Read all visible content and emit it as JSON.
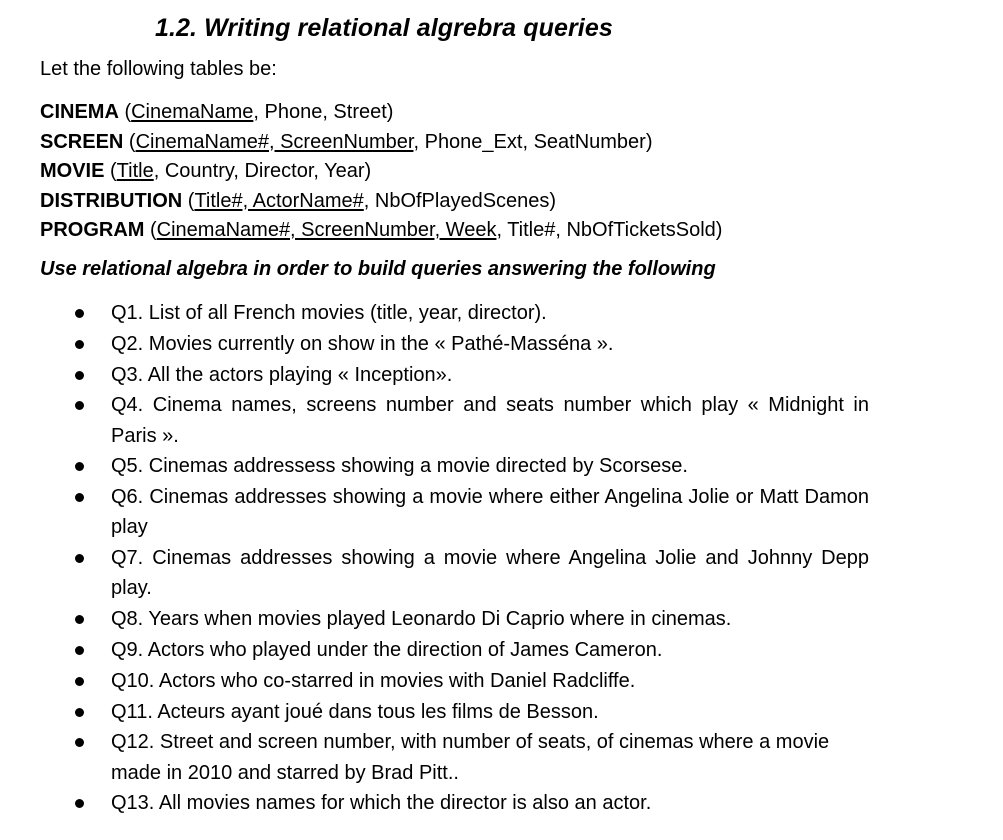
{
  "document": {
    "title": "1.2. Writing relational algrebra queries",
    "intro": "Let the following tables be:",
    "schema": [
      {
        "table": "CINEMA",
        "pre": " (",
        "key": "CinemaName",
        "post": ", Phone, Street)"
      },
      {
        "table": "SCREEN",
        "pre": " (",
        "key": "CinemaName#, ScreenNumber",
        "post": ", Phone_Ext, SeatNumber)"
      },
      {
        "table": "MOVIE",
        "pre": " (",
        "key": "Title",
        "post": ", Country, Director, Year)"
      },
      {
        "table": "DISTRIBUTION",
        "pre": " (",
        "key": "Title#, ActorName#",
        "post": ", NbOfPlayedScenes)"
      },
      {
        "table": "PROGRAM",
        "pre": " (",
        "key": "CinemaName#, ScreenNumber, Week",
        "post": ", Title#, NbOfTicketsSold)"
      }
    ],
    "instruction": "Use relational algebra in order to build queries answering the following",
    "questions": [
      "Q1. List of all French movies (title, year, director).",
      "Q2. Movies currently on show in the « Pathé-Masséna ».",
      "Q3. All the actors playing « Inception».",
      "Q4. Cinema names, screens number and seats number which play « Midnight in Paris ».",
      "Q5. Cinemas addressess showing a movie directed by Scorsese.",
      "Q6. Cinemas addresses showing a movie where either Angelina Jolie or Matt Damon play",
      "Q7. Cinemas addresses showing a movie where Angelina Jolie and Johnny Depp play.",
      "Q8. Years when movies played Leonardo Di Caprio where in cinemas.",
      "Q9. Actors who played under the direction of James Cameron.",
      "Q10. Actors who co-starred in movies with Daniel Radcliffe.",
      "Q11.  Acteurs ayant joué dans tous les films de Besson.",
      "Q12. Street and screen number, with number of seats, of cinemas where a movie made in 2010 and starred by Brad Pitt..",
      "Q13.  All movies names for which the director is also an actor."
    ]
  }
}
